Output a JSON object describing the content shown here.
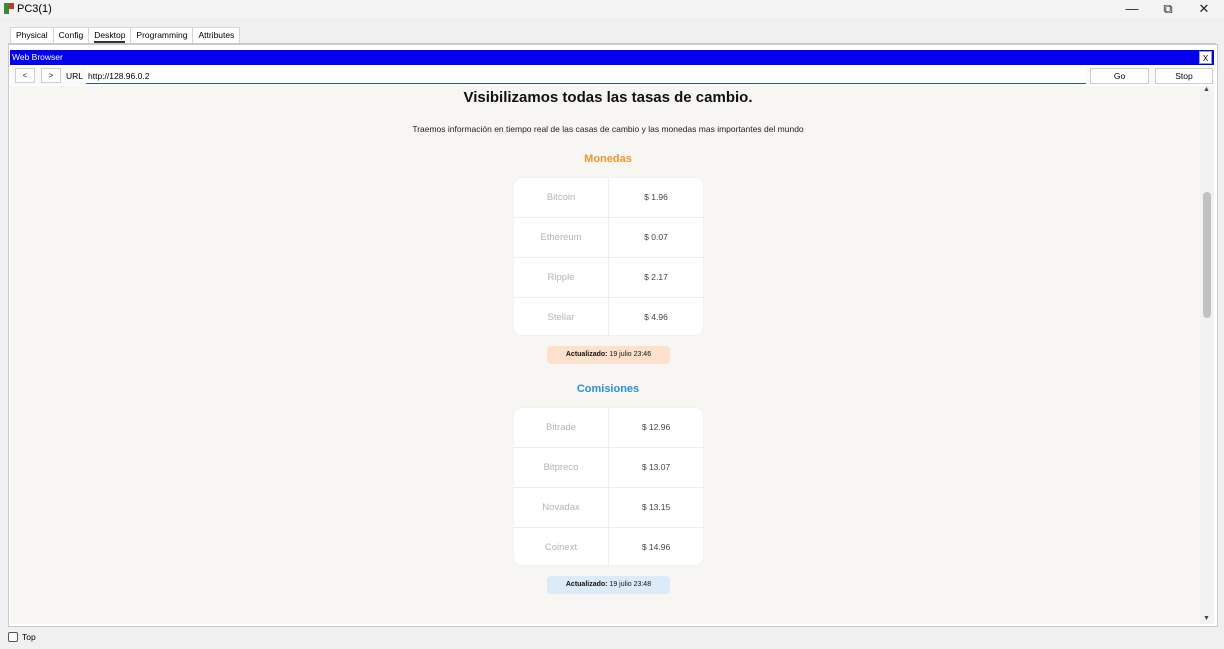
{
  "window": {
    "title": "PC3(1)",
    "minimize": "—",
    "maximize": "⧉",
    "close": "✕"
  },
  "tabs": [
    "Physical",
    "Config",
    "Desktop",
    "Programming",
    "Attributes"
  ],
  "active_tab": "Desktop",
  "browser": {
    "header_title": "Web Browser",
    "close_label": "X",
    "back_label": "<",
    "forward_label": ">",
    "url_label": "URL",
    "url_value": "http://128.96.0.2",
    "go_label": "Go",
    "stop_label": "Stop"
  },
  "page": {
    "title": "Visibilizamos todas las tasas de cambio.",
    "subtitle": "Traemos información en tiempo real de las casas de cambio y las monedas mas importantes del mundo",
    "monedas": {
      "title": "Monedas",
      "rows": [
        {
          "name": "Bitcoin",
          "value": "$ 1.96"
        },
        {
          "name": "Ethereum",
          "value": "$ 0.07"
        },
        {
          "name": "Ripple",
          "value": "$ 2.17"
        },
        {
          "name": "Stellar",
          "value": "$ 4.96"
        }
      ],
      "updated_label": "Actualizado:",
      "updated_value": "19 julio 23:46"
    },
    "comisiones": {
      "title": "Comisiones",
      "rows": [
        {
          "name": "Bitrade",
          "value": "$ 12.96"
        },
        {
          "name": "Bitpreco",
          "value": "$ 13.07"
        },
        {
          "name": "Novadax",
          "value": "$ 13.15"
        },
        {
          "name": "Coinext",
          "value": "$ 14.96"
        }
      ],
      "updated_label": "Actualizado:",
      "updated_value": "19 julio 23:48"
    }
  },
  "footer": {
    "top_label": "Top"
  },
  "colors": {
    "browser_header": "#0000ee",
    "monedas_title": "#f0962b",
    "comisiones_title": "#2e8ee0"
  }
}
